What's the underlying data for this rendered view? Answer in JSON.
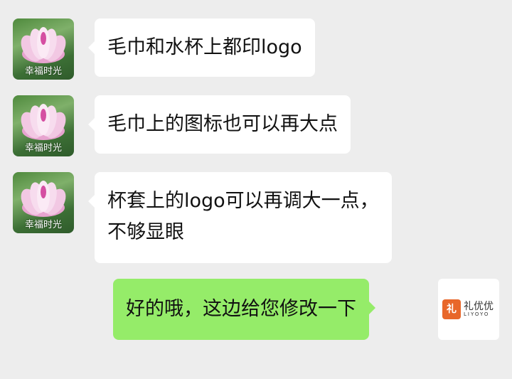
{
  "messages": [
    {
      "sender": "幸福时光",
      "text": "毛巾和水杯上都印logo"
    },
    {
      "sender": "幸福时光",
      "text": "毛巾上的图标也可以再大点"
    },
    {
      "sender": "幸福时光",
      "text_line1": "杯套上的logo可以再调大一点，",
      "text_line2": "不够显眼"
    },
    {
      "text": "好的哦，这边给您修改一下"
    }
  ],
  "contact_avatar": {
    "caption": "幸福时光",
    "icon": "lotus-icon"
  },
  "my_avatar": {
    "logo_mark": "礼",
    "logo_name": "礼优优",
    "logo_sub": "LIYOYO",
    "icon": "liyoyo-logo-icon"
  },
  "colors": {
    "background": "#ededed",
    "incoming_bubble": "#ffffff",
    "outgoing_bubble": "#95ec69",
    "logo_accent": "#e8672a"
  }
}
